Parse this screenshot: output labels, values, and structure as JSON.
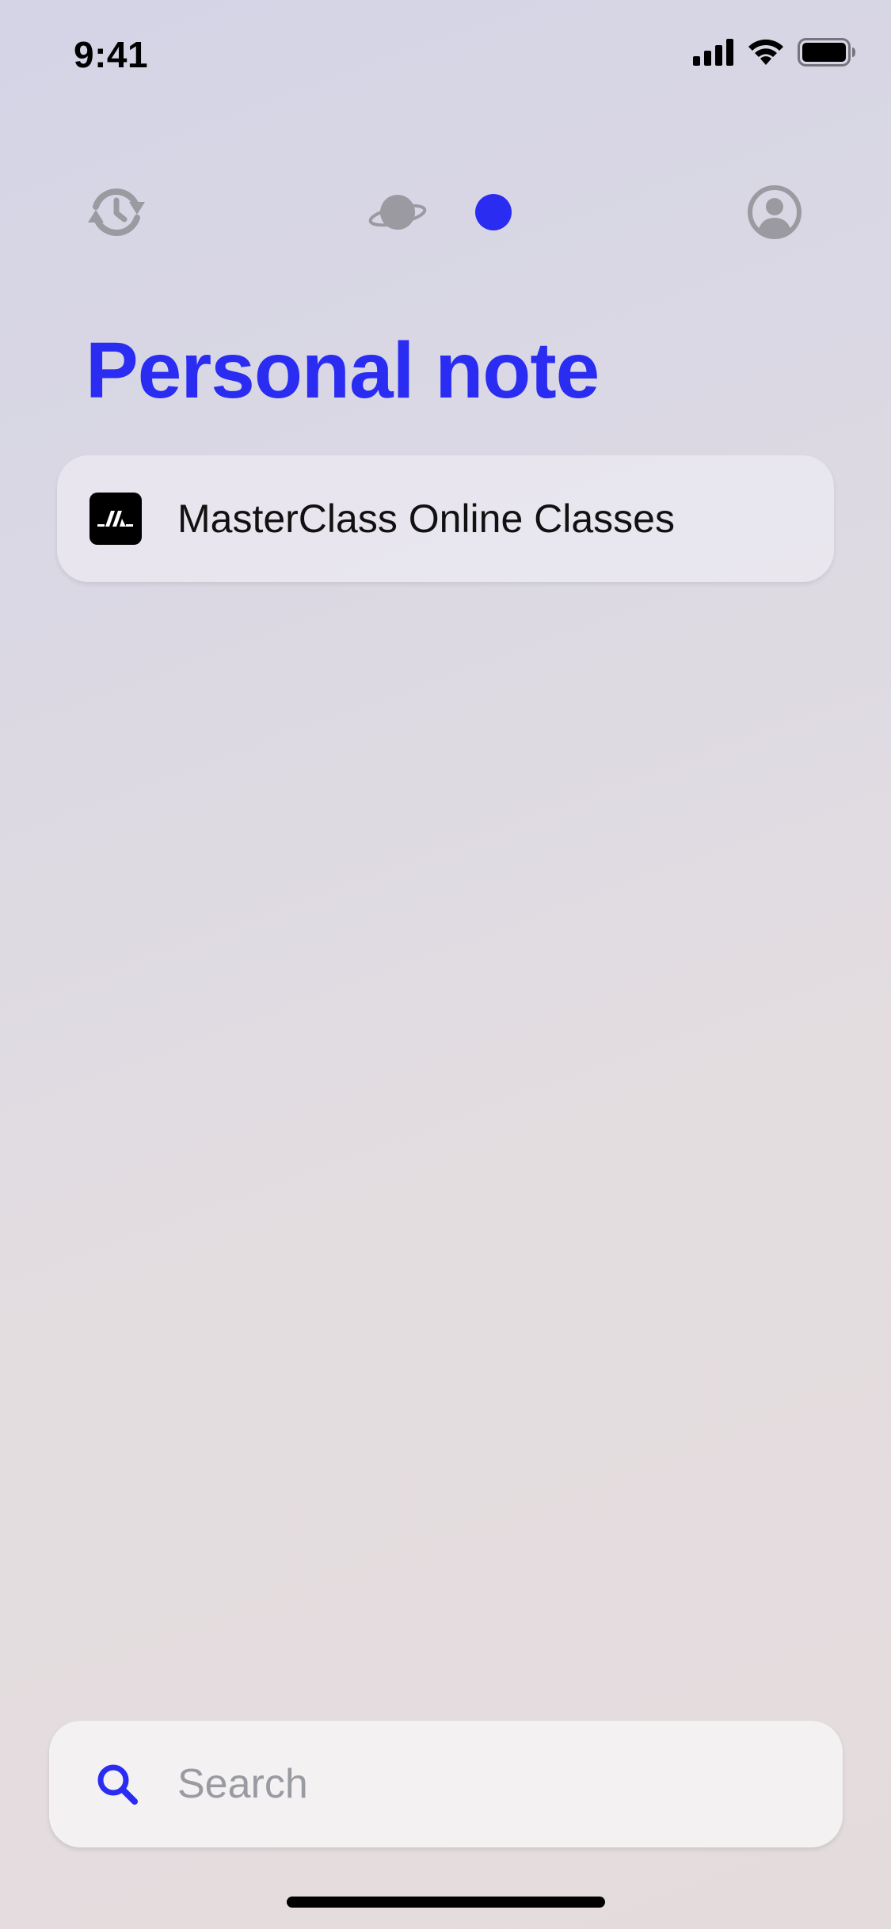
{
  "status_bar": {
    "time": "9:41"
  },
  "nav": {
    "history_icon": "history-icon",
    "explore_icon": "planet-icon",
    "personal_icon": "dot-icon",
    "profile_icon": "profile-icon",
    "active_color": "#2a2cf2",
    "inactive_color": "#9b9aa1"
  },
  "page": {
    "title": "Personal note"
  },
  "notes": [
    {
      "logo_icon": "masterclass-logo",
      "title": "MasterClass Online Classes"
    }
  ],
  "search": {
    "placeholder": "Search",
    "value": ""
  },
  "colors": {
    "accent": "#2a2cf2"
  }
}
